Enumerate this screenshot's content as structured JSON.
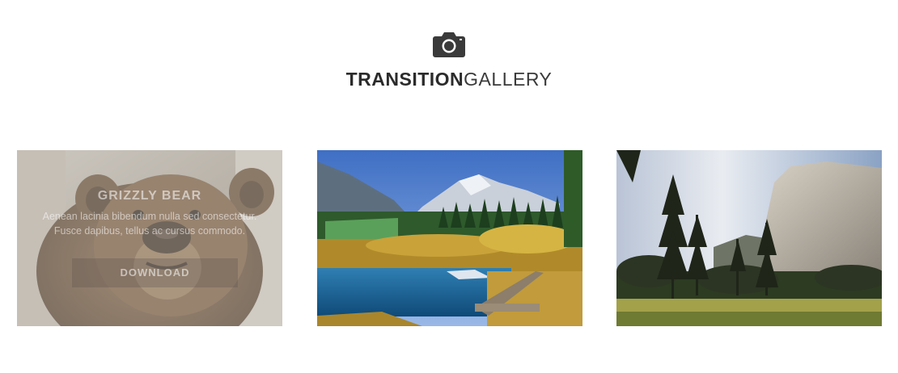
{
  "header": {
    "icon": "camera-icon",
    "title_bold": "TRANSITION",
    "title_light": "GALLERY"
  },
  "gallery": {
    "items": [
      {
        "image": "grizzly-bear-photo",
        "title": "GRIZZLY BEAR",
        "text": "Aenean lacinia bibendum nulla sed consectetur. Fusce dapibus, tellus ac cursus commodo.",
        "button_label": "DOWNLOAD",
        "hover_state": true
      },
      {
        "image": "alpine-lake-boardwalk-photo",
        "hover_state": false
      },
      {
        "image": "cliff-forest-meadow-photo",
        "hover_state": false
      }
    ]
  },
  "colors": {
    "title": "#2b2b2b",
    "background": "#ffffff"
  }
}
